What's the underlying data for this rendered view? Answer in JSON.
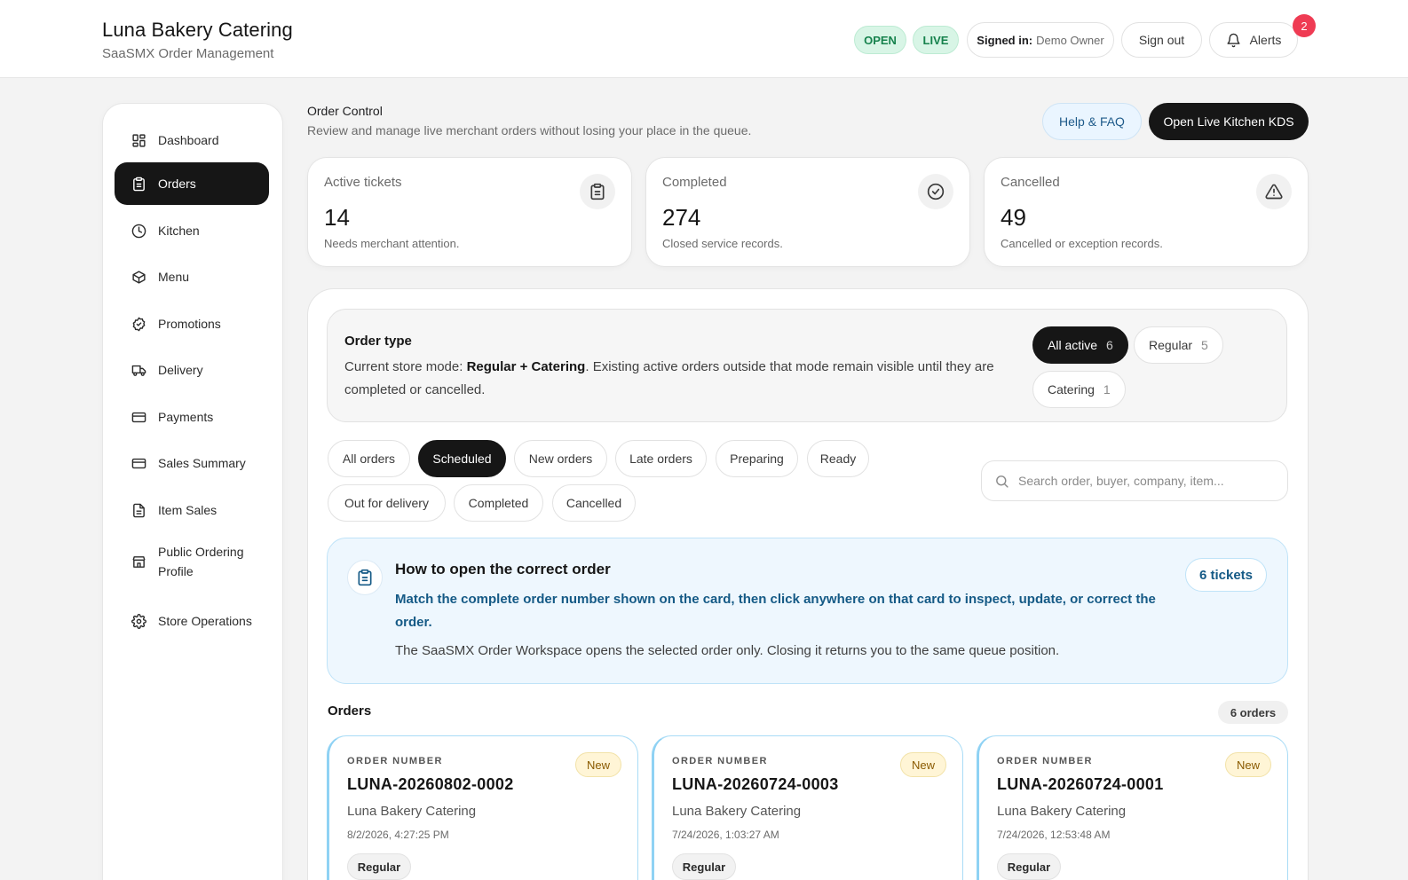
{
  "header": {
    "app_title": "Luna Bakery Catering",
    "app_subtitle": "SaaSMX Order Management",
    "status_open": "OPEN",
    "status_live": "LIVE",
    "signed_in_label": "Signed in:",
    "signed_in_user": "Demo Owner",
    "sign_out": "Sign out",
    "alerts_label": "Alerts",
    "alerts_count": "2"
  },
  "sidebar": {
    "items": [
      {
        "label": "Dashboard",
        "icon": "grid-icon"
      },
      {
        "label": "Orders",
        "icon": "clipboard-icon",
        "active": true
      },
      {
        "label": "Kitchen",
        "icon": "clock-icon"
      },
      {
        "label": "Menu",
        "icon": "box-icon"
      },
      {
        "label": "Promotions",
        "icon": "check-badge-icon"
      },
      {
        "label": "Delivery",
        "icon": "truck-icon"
      },
      {
        "label": "Payments",
        "icon": "credit-card-icon"
      },
      {
        "label": "Sales Summary",
        "icon": "credit-card-icon"
      },
      {
        "label": "Item Sales",
        "icon": "document-icon"
      },
      {
        "label": "Public Ordering Profile",
        "icon": "store-icon"
      },
      {
        "label": "Store Operations",
        "icon": "gear-icon"
      }
    ]
  },
  "main": {
    "title": "Order Control",
    "subtitle": "Review and manage live merchant orders without losing your place in the queue.",
    "help_button": "Help & FAQ",
    "kds_button": "Open Live Kitchen KDS"
  },
  "stats": [
    {
      "title": "Active tickets",
      "value": "14",
      "desc": "Needs merchant attention.",
      "icon": "clipboard-icon"
    },
    {
      "title": "Completed",
      "value": "274",
      "desc": "Closed service records.",
      "icon": "check-circle-icon"
    },
    {
      "title": "Cancelled",
      "value": "49",
      "desc": "Cancelled or exception records.",
      "icon": "warning-icon"
    }
  ],
  "order_type": {
    "heading": "Order type",
    "text_prefix": "Current store mode: ",
    "mode": "Regular + Catering",
    "text_suffix": ". Existing active orders outside that mode remain visible until they are completed or cancelled.",
    "segments": [
      {
        "label": "All active",
        "count": "6",
        "active": true
      },
      {
        "label": "Regular",
        "count": "5"
      },
      {
        "label": "Catering",
        "count": "1"
      }
    ]
  },
  "filters": {
    "chips": [
      "All orders",
      "Scheduled",
      "New orders",
      "Late orders",
      "Preparing",
      "Ready",
      "Out for delivery",
      "Completed",
      "Cancelled"
    ],
    "active": "Scheduled",
    "search_placeholder": "Search order, buyer, company, item..."
  },
  "info": {
    "heading": "How to open the correct order",
    "body": "Match the complete order number shown on the card, then click anywhere on that card to inspect, update, or correct the order.",
    "note": "The SaaSMX Order Workspace opens the selected order only. Closing it returns you to the same queue position.",
    "tickets": "6 tickets"
  },
  "orders": {
    "heading": "Orders",
    "count": "6 orders",
    "key_label": "ORDER NUMBER",
    "items": [
      {
        "number": "LUNA-20260802-0002",
        "merchant": "Luna Bakery Catering",
        "date": "8/2/2026, 4:27:25 PM",
        "status": "New",
        "type": "Regular"
      },
      {
        "number": "LUNA-20260724-0003",
        "merchant": "Luna Bakery Catering",
        "date": "7/24/2026, 1:03:27 AM",
        "status": "New",
        "type": "Regular"
      },
      {
        "number": "LUNA-20260724-0001",
        "merchant": "Luna Bakery Catering",
        "date": "7/24/2026, 12:53:48 AM",
        "status": "New",
        "type": "Regular"
      }
    ]
  },
  "colors": {
    "accent_dark": "#161616",
    "status_green": "#16824d",
    "alert_red": "#ef3b53",
    "info_blue": "#155a86"
  }
}
